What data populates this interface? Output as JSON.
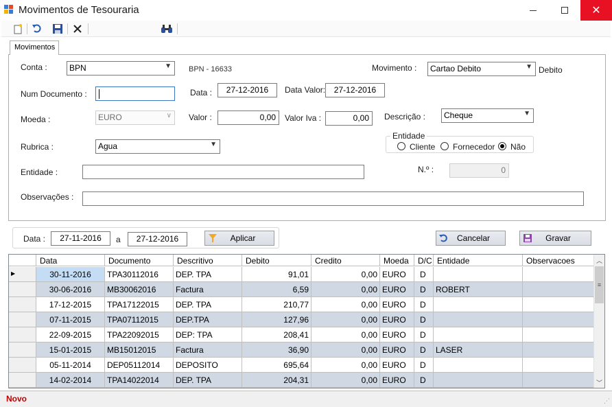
{
  "window": {
    "title": "Movimentos de Tesouraria"
  },
  "toolbar": {
    "buttons": [
      "new-icon",
      "undo-icon",
      "save-icon",
      "delete-icon",
      "search-icon"
    ]
  },
  "tab": {
    "label": "Movimentos"
  },
  "form": {
    "conta_label": "Conta :",
    "conta_value": "BPN",
    "conta_info": "BPN - 16633",
    "movimento_label": "Movimento :",
    "movimento_value": "Cartao Debito",
    "movimento_info": "Debito",
    "num_doc_label": "Num Documento :",
    "num_doc_value": "",
    "data_label": "Data :",
    "data_value": "27-12-2016",
    "data_valor_label": "Data Valor:",
    "data_valor_value": "27-12-2016",
    "moeda_label": "Moeda :",
    "moeda_value": "EURO",
    "valor_label": "Valor :",
    "valor_value": "0,00",
    "valor_iva_label": "Valor Iva :",
    "valor_iva_value": "0,00",
    "descricao_label": "Descrição :",
    "descricao_value": "Cheque",
    "rubrica_label": "Rubrica :",
    "rubrica_value": "Agua",
    "entidade_group_label": "Entidade",
    "entidade_options": [
      "Cliente",
      "Fornecedor",
      "Não"
    ],
    "entidade_selected": "Não",
    "entidade_label": "Entidade :",
    "entidade_value": "",
    "numero_label": "N.º :",
    "numero_value": "0",
    "observacoes_label": "Observações :",
    "observacoes_value": ""
  },
  "filter": {
    "data_label": "Data :",
    "from": "27-11-2016",
    "sep": "a",
    "to": "27-12-2016",
    "apply_label": "Aplicar",
    "cancel_label": "Cancelar",
    "save_label": "Gravar"
  },
  "grid": {
    "columns": [
      "Data",
      "Documento",
      "Descritivo",
      "Debito",
      "Credito",
      "Moeda",
      "D/C",
      "Entidade",
      "Observacoes"
    ],
    "rows": [
      {
        "data": "30-11-2016",
        "doc": "TPA30112016",
        "desc": "DEP. TPA",
        "debito": "91,01",
        "credito": "0,00",
        "moeda": "EURO",
        "dc": "D",
        "entidade": "",
        "obs": ""
      },
      {
        "data": "30-06-2016",
        "doc": "MB30062016",
        "desc": "Factura",
        "debito": "6,59",
        "credito": "0,00",
        "moeda": "EURO",
        "dc": "D",
        "entidade": "ROBERT",
        "obs": ""
      },
      {
        "data": "17-12-2015",
        "doc": "TPA17122015",
        "desc": "DEP. TPA",
        "debito": "210,77",
        "credito": "0,00",
        "moeda": "EURO",
        "dc": "D",
        "entidade": "",
        "obs": ""
      },
      {
        "data": "07-11-2015",
        "doc": "TPA07112015",
        "desc": "DEP.TPA",
        "debito": "127,96",
        "credito": "0,00",
        "moeda": "EURO",
        "dc": "D",
        "entidade": "",
        "obs": ""
      },
      {
        "data": "22-09-2015",
        "doc": "TPA22092015",
        "desc": "DEP: TPA",
        "debito": "208,41",
        "credito": "0,00",
        "moeda": "EURO",
        "dc": "D",
        "entidade": "",
        "obs": ""
      },
      {
        "data": "15-01-2015",
        "doc": "MB15012015",
        "desc": "Factura",
        "debito": "36,90",
        "credito": "0,00",
        "moeda": "EURO",
        "dc": "D",
        "entidade": "LASER",
        "obs": ""
      },
      {
        "data": "05-11-2014",
        "doc": "DEP05112014",
        "desc": "DEPOSITO",
        "debito": "695,64",
        "credito": "0,00",
        "moeda": "EURO",
        "dc": "D",
        "entidade": "",
        "obs": ""
      },
      {
        "data": "14-02-2014",
        "doc": "TPA14022014",
        "desc": "DEP. TPA",
        "debito": "204,31",
        "credito": "0,00",
        "moeda": "EURO",
        "dc": "D",
        "entidade": "",
        "obs": ""
      }
    ]
  },
  "status": {
    "text": "Novo"
  },
  "colors": {
    "alt_row": "#cfd8e3",
    "selected": "#c5dcf5",
    "status_text": "#c00000"
  }
}
